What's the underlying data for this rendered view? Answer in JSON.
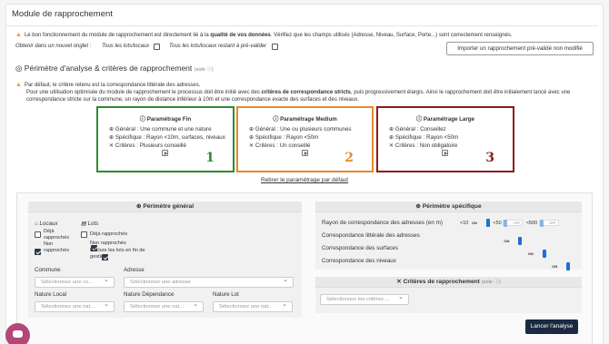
{
  "page_title": "Module de rapprochement",
  "notice": {
    "text_pre": "Le bon fonctionnement du module de rapprochement est directement lié à la ",
    "text_bold": "qualité de vos données",
    "text_post": ". Vérifiez que les champs utilisés (Adresse, Niveau, Surface, Porte...) sont correctement renseignés."
  },
  "onglet": {
    "label": "Obtenir dans un nouvel onglet :",
    "opt1": "Tous les lots/locaux",
    "opt2": "Tous les lots/locaux restant à pré-valider"
  },
  "import_button": "Importer un rapprochement pré-validé non modifié",
  "perimetre": {
    "title": "Périmètre d'analyse & critères de rapprochement",
    "aide": "(aide ⓘ)",
    "info_line1": "Par défaut, le critère retenu est la correspondance littérale des adresses.",
    "info_line2_pre": "Pour une utilisation optimisée du module de rapprochement le processus doit être initié avec des ",
    "info_line2_bold": "critères de correspondance stricts",
    "info_line2_post": ", puis progressivement élargis. Ainsi le rapprochement doit être initialement lancé avec une",
    "info_line3": "correspondance stricte sur la commune, un rayon de distance inférieur à 10m et une correspondance exacte des surfaces et des niveaux."
  },
  "params": [
    {
      "title": "Paramétrage Fin",
      "general": "Général : Une commune et une nature",
      "specific": "Spécifique : Rayon <10m, surfaces, niveaux",
      "criteres": "Critères : Plusieurs conseillé",
      "number": "1",
      "color": "#2e8b2e"
    },
    {
      "title": "Paramétrage Medium",
      "general": "Général : Une ou plusieurs communes",
      "specific": "Spécifique : Rayon <50m",
      "criteres": "Critères : Un conseillé",
      "number": "2",
      "color": "#e8892b"
    },
    {
      "title": "Paramétrage Large",
      "general": "Général : Conseillez",
      "specific": "Spécifique : Rayon <50m",
      "criteres": "Critères : Non obligatoire",
      "number": "3",
      "color": "#8b1a1a"
    }
  ],
  "reset_link": "Retirer le paramétrage par défaut",
  "general_panel": {
    "title": "Périmètre général",
    "locaux": "Locaux",
    "lots": "Lots",
    "locaux_opts": [
      {
        "label1": "Déjà",
        "label2": "rapprochés",
        "checked": false
      },
      {
        "label1": "Non",
        "label2": "rapprochés",
        "checked": true
      }
    ],
    "lots_opts": [
      {
        "label": "Déjà rapprochés",
        "checked": false
      },
      {
        "label": "Non rapprochés",
        "checked": true
      },
      {
        "label1": "Exclure les lots en fin de",
        "label2": "gestion",
        "checked": true
      }
    ],
    "commune_label": "Commune",
    "commune_ph": "Sélectionnez une co...",
    "adresse_label": "Adresse",
    "adresse_ph": "Sélectionnez une adresse",
    "nature_local_label": "Nature Local",
    "nature_local_ph": "Sélectionnez une nat...",
    "nature_dep_label": "Nature Dépendance",
    "nature_dep_ph": "Sélectionnez une nat...",
    "nature_lot_label": "Nature Lot",
    "nature_lot_ph": "Sélectionnez une nat..."
  },
  "specific_panel": {
    "title": "Périmètre spécifique",
    "rayon_label": "Rayon de correspondance des adresses (en m)",
    "rayon_opts": [
      {
        "label": "<10",
        "state": "ON"
      },
      {
        "label": "<50",
        "state": "OFF"
      },
      {
        "label": "<500",
        "state": "OFF"
      }
    ],
    "rows": [
      {
        "label": "Correspondance littérale des adresses",
        "state": "ON"
      },
      {
        "label": "Correspondance des surfaces",
        "state": "ON"
      },
      {
        "label": "Correspondance des niveaux",
        "state": "ON"
      }
    ]
  },
  "criteres_panel": {
    "title": "Critères de rapprochement",
    "aide": "(aide ⓘ)",
    "placeholder": "Sélectionnez les critères ..."
  },
  "launch_button": "Lancer l'analyse"
}
